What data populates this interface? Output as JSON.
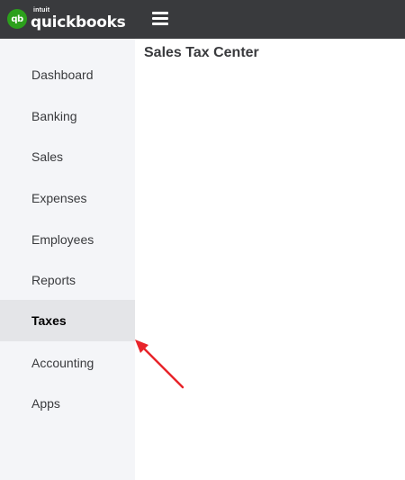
{
  "brand": {
    "badge": "qb",
    "intuit": "intuit",
    "name": "quickbooks"
  },
  "header": {
    "menu_icon": "hamburger-menu-icon"
  },
  "sidebar": {
    "items": [
      {
        "label": "Dashboard"
      },
      {
        "label": "Banking"
      },
      {
        "label": "Sales"
      },
      {
        "label": "Expenses"
      },
      {
        "label": "Employees"
      },
      {
        "label": "Reports"
      },
      {
        "label": "Taxes",
        "active": true
      },
      {
        "label": "Accounting"
      },
      {
        "label": "Apps"
      }
    ]
  },
  "main": {
    "title": "Sales Tax Center"
  },
  "annotation": {
    "arrow_color": "#e8242a",
    "arrow_icon": "arrow-pointer-icon"
  },
  "colors": {
    "topbar": "#393a3d",
    "brand_green": "#2ca01c",
    "sidebar_bg": "#f4f5f8",
    "active_item_bg": "#e4e5e8"
  }
}
